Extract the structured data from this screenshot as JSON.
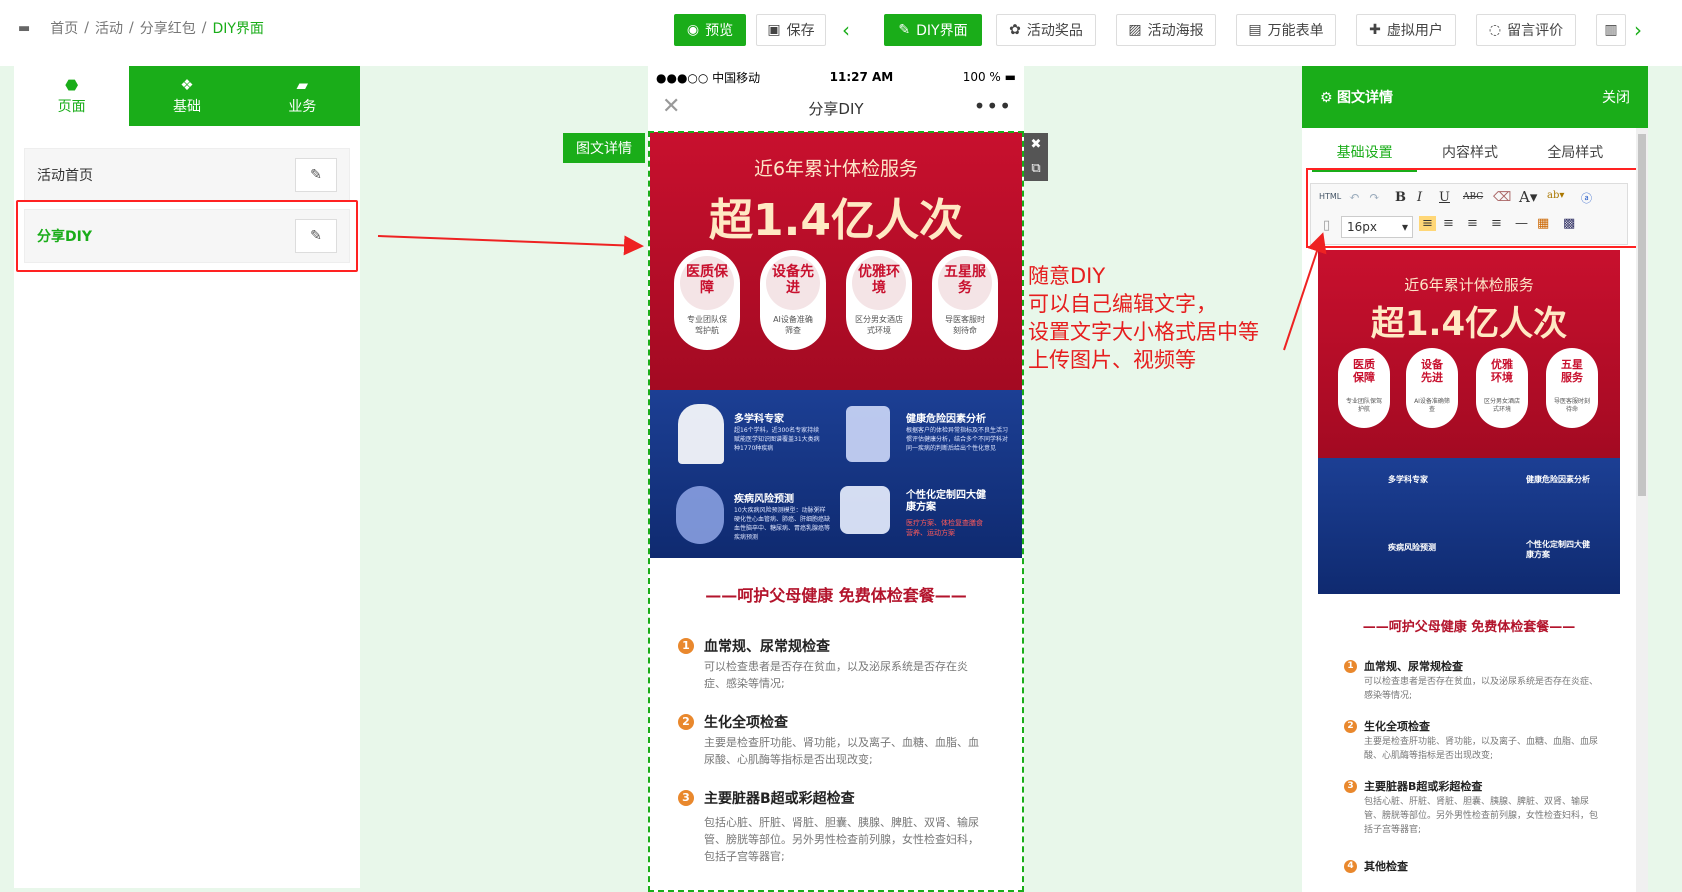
{
  "breadcrumb": {
    "items": [
      "首页",
      "活动",
      "分享红包",
      "DIY界面"
    ],
    "sep": "/"
  },
  "toolbar": {
    "preview": "预览",
    "save": "保存",
    "diy": "DIY界面",
    "prize": "活动奖品",
    "poster": "活动海报",
    "form": "万能表单",
    "virtual": "虚拟用户",
    "comment": "留言评价"
  },
  "left": {
    "tabs": [
      "页面",
      "基础",
      "业务"
    ],
    "pages": [
      {
        "label": "活动首页"
      },
      {
        "label": "分享DIY"
      }
    ]
  },
  "phone": {
    "carrier": "●●●○○ 中国移动",
    "time": "11:27 AM",
    "battery": "100 %",
    "title": "分享DIY",
    "tag": "图文详情",
    "banner": {
      "line1": "近6年累计体检服务",
      "line2": "超1.4亿人次",
      "pills": [
        {
          "t": "医质保障",
          "s": "专业团队保驾护航"
        },
        {
          "t": "设备先进",
          "s": "AI设备准确筛查"
        },
        {
          "t": "优雅环境",
          "s": "区分男女酒店式环境"
        },
        {
          "t": "五星服务",
          "s": "导医客服时刻待命"
        }
      ],
      "features": [
        {
          "t": "多学科专家",
          "d": "超16个学科，近300名专家持续赋能医学知识图谱覆盖31大类病种1770种疾病"
        },
        {
          "t": "健康危险因素分析",
          "d": "根据客户的体检异常指标及不良生活习惯评估健康分析，结合多个不同学科对同一疾病的判断后给出个性化意见"
        },
        {
          "t": "疾病风险预测",
          "d": "10大疾病风险预测模型：动脉粥样硬化性心血管病、肺癌、肝细胞癌缺血性脑卒中、糖尿病、胃癌乳腺癌等疾病预测"
        },
        {
          "t": "个性化定制四大健康方案",
          "d": "医疗方案、体检复查膳食营养、运动方案"
        }
      ]
    },
    "article": {
      "title": "——呵护父母健康  免费体检套餐——",
      "items": [
        {
          "n": "1",
          "h": "血常规、尿常规检查",
          "d": "可以检查患者是否存在贫血，以及泌尿系统是否存在炎症、感染等情况;"
        },
        {
          "n": "2",
          "h": "生化全项检查",
          "d": "主要是检查肝功能、肾功能，以及离子、血糖、血脂、血尿酸、心肌酶等指标是否出现改变;"
        },
        {
          "n": "3",
          "h": "主要脏器B超或彩超检查",
          "d": "包括心脏、肝脏、肾脏、胆囊、胰腺、脾脏、双肾、输尿管、膀胱等部位。另外男性检查前列腺，女性检查妇科，包括子宫等器官;"
        }
      ],
      "item4": {
        "n": "4",
        "h": "其他检查"
      }
    }
  },
  "annotation": [
    "随意DIY",
    "可以自己编辑文字，",
    "设置文字大小格式居中等",
    "上传图片、视频等"
  ],
  "right": {
    "title": "图文详情",
    "close": "关闭",
    "tabs": [
      "基础设置",
      "内容样式",
      "全局样式"
    ],
    "font_size": "16px",
    "html_label": "HTML"
  },
  "colors": {
    "brand": "#1aad19",
    "alert": "#ee2222",
    "banner_red": "#c8102e",
    "banner_blue": "#1c3f94",
    "number": "#e9882d"
  }
}
